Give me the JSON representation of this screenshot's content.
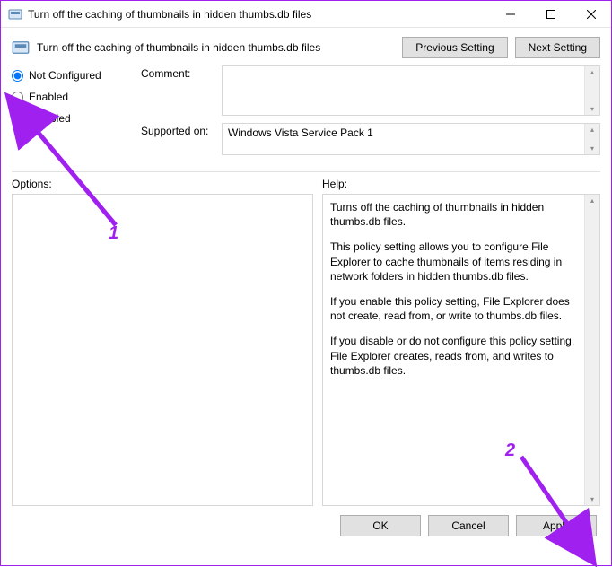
{
  "window": {
    "title": "Turn off the caching of thumbnails in hidden thumbs.db files"
  },
  "header": {
    "policy_title": "Turn off the caching of thumbnails in hidden thumbs.db files",
    "previous_btn": "Previous Setting",
    "next_btn": "Next Setting"
  },
  "radios": {
    "not_configured": "Not Configured",
    "enabled": "Enabled",
    "disabled": "Disabled"
  },
  "fields": {
    "comment_label": "Comment:",
    "comment_value": "",
    "supported_label": "Supported on:",
    "supported_value": "Windows Vista Service Pack 1"
  },
  "lower": {
    "options_label": "Options:",
    "help_label": "Help:",
    "options_value": "",
    "help_paras": [
      "Turns off the caching of thumbnails in hidden thumbs.db files.",
      "This policy setting allows you to configure File Explorer to cache thumbnails of items residing in network folders in hidden thumbs.db files.",
      "If you enable this policy setting, File Explorer does not create, read from, or write to thumbs.db files.",
      "If you disable or do not configure this policy setting, File Explorer creates, reads from, and writes to thumbs.db files."
    ]
  },
  "footer": {
    "ok": "OK",
    "cancel": "Cancel",
    "apply": "Apply"
  },
  "annotations": {
    "num1": "1",
    "num2": "2"
  }
}
